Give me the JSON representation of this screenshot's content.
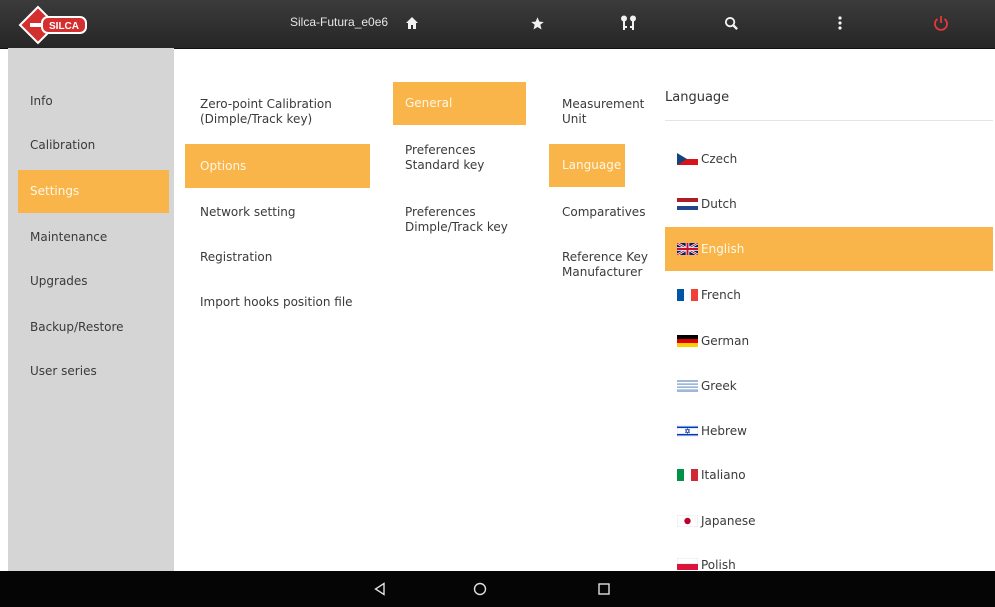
{
  "topbar": {
    "device_name": "Silca-Futura_e0e6",
    "logo_text": "SILCA",
    "icons": [
      "home-icon",
      "star-icon",
      "keys-icon",
      "search-icon",
      "more-vertical-icon",
      "power-icon"
    ],
    "power_color": "#e53935"
  },
  "sidebar": {
    "items": [
      {
        "label": "Info"
      },
      {
        "label": "Calibration"
      },
      {
        "label": "Settings",
        "active": true
      },
      {
        "label": "Maintenance"
      },
      {
        "label": "Upgrades"
      },
      {
        "label": "Backup/Restore"
      },
      {
        "label": "User series"
      }
    ]
  },
  "settings_menu": {
    "items": [
      {
        "label": "Zero-point Calibration (Dimple/Track key)"
      },
      {
        "label": "Options",
        "active": true
      },
      {
        "label": "Network setting"
      },
      {
        "label": "Registration"
      },
      {
        "label": "Import hooks position file"
      }
    ]
  },
  "options_menu": {
    "items": [
      {
        "label": "General",
        "active": true
      },
      {
        "label": "Preferences Standard key"
      },
      {
        "label": "Preferences Dimple/Track key"
      }
    ]
  },
  "general_menu": {
    "items": [
      {
        "label": "Measurement Unit"
      },
      {
        "label": "Language",
        "active": true
      },
      {
        "label": "Comparatives"
      },
      {
        "label": "Reference Key Manufacturer"
      }
    ]
  },
  "language_panel": {
    "title": "Language",
    "options": [
      {
        "label": "Czech",
        "flag": "czech-flag-icon"
      },
      {
        "label": "Dutch",
        "flag": "dutch-flag-icon"
      },
      {
        "label": "English",
        "flag": "uk-flag-icon",
        "selected": true
      },
      {
        "label": "French",
        "flag": "french-flag-icon"
      },
      {
        "label": "German",
        "flag": "german-flag-icon"
      },
      {
        "label": "Greek",
        "flag": "greek-flag-icon"
      },
      {
        "label": "Hebrew",
        "flag": "israel-flag-icon"
      },
      {
        "label": "Italiano",
        "flag": "italian-flag-icon"
      },
      {
        "label": "Japanese",
        "flag": "japanese-flag-icon"
      },
      {
        "label": "Polish",
        "flag": "polish-flag-icon"
      }
    ]
  },
  "navbar": {
    "icons": [
      "back-icon",
      "home-circle-icon",
      "recents-icon"
    ]
  },
  "colors": {
    "accent": "#f9b54a",
    "topbar": "#2e2e2e",
    "sidebar": "#d5d5d5"
  }
}
